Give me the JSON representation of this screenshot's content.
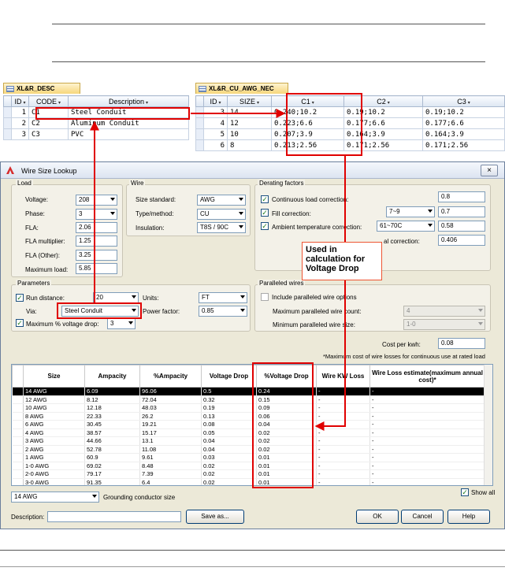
{
  "desc_table": {
    "tab": "XL&R_DESC",
    "headers": [
      "ID",
      "CODE",
      "Description"
    ],
    "rows": [
      {
        "id": "1",
        "code": "C1",
        "desc": "Steel Conduit"
      },
      {
        "id": "2",
        "code": "C2",
        "desc": "Aluminum Conduit"
      },
      {
        "id": "3",
        "code": "C3",
        "desc": "PVC"
      }
    ]
  },
  "awg_table": {
    "tab": "XL&R_CU_AWG_NEC",
    "headers": [
      "ID",
      "SIZE",
      "C1",
      "C2",
      "C3"
    ],
    "rows": [
      {
        "id": "3",
        "size": "14",
        "c1": "0.240;10.2",
        "c2": "0.19;10.2",
        "c3": "0.19;10.2"
      },
      {
        "id": "4",
        "size": "12",
        "c1": "0.223;6.6",
        "c2": "0.177;6.6",
        "c3": "0.177;6.6"
      },
      {
        "id": "5",
        "size": "10",
        "c1": "0.207;3.9",
        "c2": "0.164;3.9",
        "c3": "0.164;3.9"
      },
      {
        "id": "6",
        "size": "8",
        "c1": "0.213;2.56",
        "c2": "0.171;2.56",
        "c3": "0.171;2.56"
      }
    ]
  },
  "dialog": {
    "title": "Wire Size Lookup",
    "close": "×",
    "load": {
      "group": "Load",
      "voltage_label": "Voltage:",
      "voltage": "208",
      "phase_label": "Phase:",
      "phase": "3",
      "fla_label": "FLA:",
      "fla": "2.06",
      "fla_mult_label": "FLA multiplier:",
      "fla_mult": "1.25",
      "fla_other_label": "FLA (Other):",
      "fla_other": "3.25",
      "max_load_label": "Maximum load:",
      "max_load": "5.85"
    },
    "wire": {
      "group": "Wire",
      "size_std_label": "Size standard:",
      "size_std": "AWG",
      "type_label": "Type/method:",
      "type": "CU",
      "insulation_label": "Insulation:",
      "insulation": "T8S / 90C"
    },
    "derating": {
      "group": "Derating factors",
      "continuous_label": "Continuous load correction:",
      "continuous": "0.8",
      "fill_label": "Fill correction:",
      "fill_combo": "7~9",
      "fill": "0.7",
      "ambient_label": "Ambient temperature correction:",
      "ambient_combo": "61~70C",
      "ambient": "0.58",
      "total_label": "al correction:",
      "total": "0.406"
    },
    "parameters": {
      "group": "Parameters",
      "run_label": "Run distance:",
      "run": "20",
      "units_label": "Units:",
      "units": "FT",
      "via_label": "Via:",
      "via": "Steel Conduit",
      "pf_label": "Power factor:",
      "pf": "0.85",
      "maxvd_label": "Maximum % voltage drop:",
      "maxvd": "3"
    },
    "paralleled": {
      "group": "Paralleled wires",
      "include_label": "Include paralleled wire options",
      "max_count_label": "Maximum paralleled wire count:",
      "max_count": "4",
      "min_size_label": "Minimum paralleled wire size:",
      "min_size": "1-0"
    },
    "cost_label": "Cost per kwh:",
    "cost": "0.08",
    "cost_note": "*Maximum cost of wire losses for continuous use at rated load",
    "grid": {
      "headers": [
        "Size",
        "Ampacity",
        "%Ampacity",
        "Voltage Drop",
        "%Voltage Drop",
        "Wire KW Loss",
        "Wire Loss estimate(maximum annual cost)*"
      ],
      "rows": [
        [
          "14 AWG",
          "6.09",
          "96.06",
          "0.5",
          "0.24",
          "-",
          "-"
        ],
        [
          "12 AWG",
          "8.12",
          "72.04",
          "0.32",
          "0.15",
          "-",
          "-"
        ],
        [
          "10 AWG",
          "12.18",
          "48.03",
          "0.19",
          "0.09",
          "-",
          "-"
        ],
        [
          "8 AWG",
          "22.33",
          "26.2",
          "0.13",
          "0.06",
          "-",
          "-"
        ],
        [
          "6 AWG",
          "30.45",
          "19.21",
          "0.08",
          "0.04",
          "-",
          "-"
        ],
        [
          "4 AWG",
          "38.57",
          "15.17",
          "0.05",
          "0.02",
          "-",
          "-"
        ],
        [
          "3 AWG",
          "44.66",
          "13.1",
          "0.04",
          "0.02",
          "-",
          "-"
        ],
        [
          "2 AWG",
          "52.78",
          "11.08",
          "0.04",
          "0.02",
          "-",
          "-"
        ],
        [
          "1 AWG",
          "60.9",
          "9.61",
          "0.03",
          "0.01",
          "-",
          "-"
        ],
        [
          "1-0 AWG",
          "69.02",
          "8.48",
          "0.02",
          "0.01",
          "-",
          "-"
        ],
        [
          "2-0 AWG",
          "79.17",
          "7.39",
          "0.02",
          "0.01",
          "-",
          "-"
        ],
        [
          "3-0 AWG",
          "91.35",
          "6.4",
          "0.02",
          "0.01",
          "-",
          "-"
        ]
      ]
    },
    "ground_size": "14 AWG",
    "ground_label": "Grounding conductor size",
    "show_all": "Show all",
    "description_label": "Description:",
    "save_as": "Save as...",
    "ok": "OK",
    "cancel": "Cancel",
    "help": "Help"
  },
  "annotation": "Used in calculation for Voltage Drop",
  "colors": {
    "highlight": "#e00000",
    "selected_row": "#000000"
  }
}
